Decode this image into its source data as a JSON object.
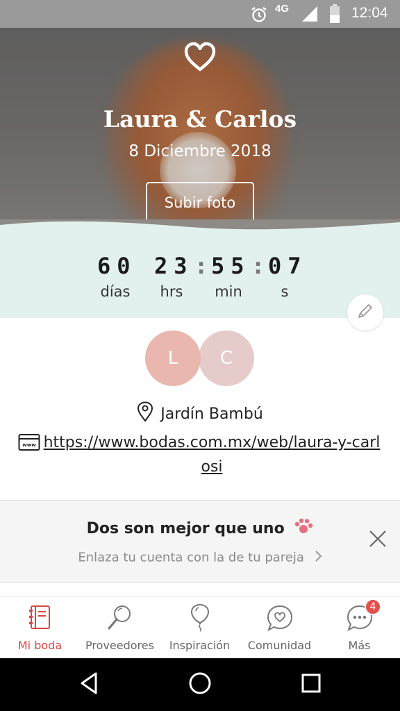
{
  "status_bar": {
    "network": "4G",
    "time": "12:04"
  },
  "hero": {
    "names": "Laura & Carlos",
    "date": "8 Diciembre 2018",
    "upload_button": "Subir foto"
  },
  "countdown": {
    "days": "60",
    "hours": "23",
    "minutes": "55",
    "seconds": "07",
    "separator": ":",
    "labels": {
      "days": "días",
      "hours": "hrs",
      "minutes": "min",
      "seconds": "s"
    }
  },
  "couple": {
    "partner1_initial": "L",
    "partner2_initial": "C",
    "venue": "Jardín Bambú",
    "website": "https://www.bodas.com.mx/web/laura-y-carlosi"
  },
  "promo": {
    "title": "Dos son mejor que uno",
    "subtitle": "Enlaza tu cuenta con la de tu pareja"
  },
  "bottom_nav": {
    "items": [
      {
        "label": "Mi boda",
        "icon": "planner-icon"
      },
      {
        "label": "Proveedores",
        "icon": "search-icon"
      },
      {
        "label": "Inspiración",
        "icon": "balloon-icon"
      },
      {
        "label": "Comunidad",
        "icon": "chat-heart-icon"
      },
      {
        "label": "Más",
        "icon": "more-icon"
      }
    ],
    "more_badge": "4"
  },
  "colors": {
    "accent": "#d9463f",
    "mint": "#e3f1ee",
    "avatar_l": "#e9b7ad",
    "avatar_c": "#e6cbcb"
  }
}
